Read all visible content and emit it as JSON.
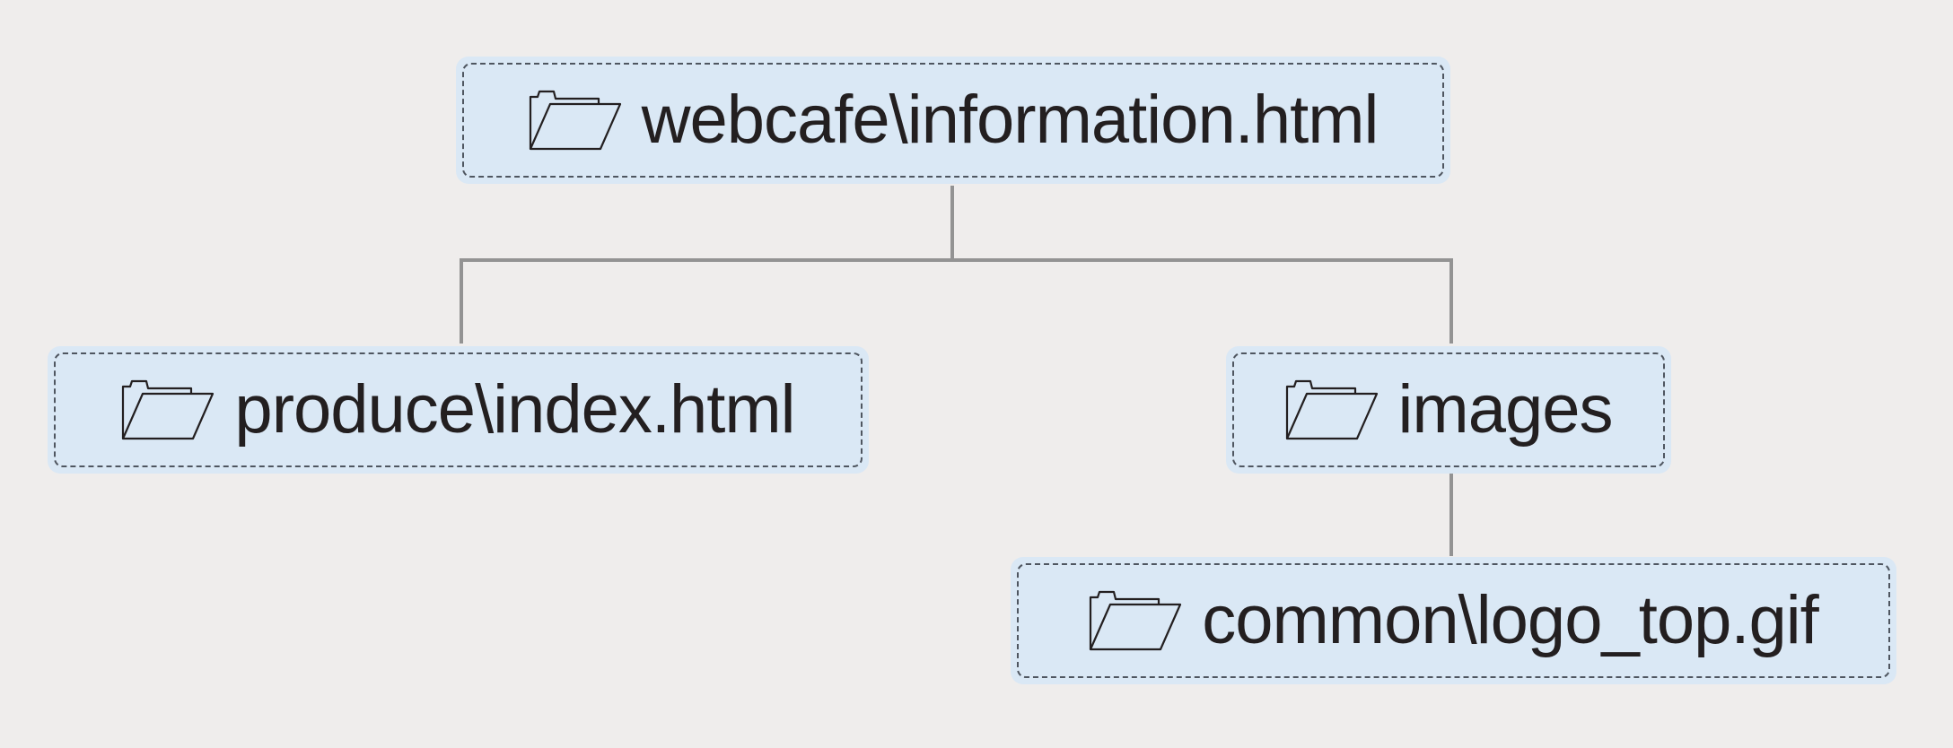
{
  "tree": {
    "root": {
      "label": "webcafe\\information.html",
      "icon": "folder-icon"
    },
    "children": [
      {
        "label": "produce\\index.html",
        "icon": "folder-icon"
      },
      {
        "label": "images",
        "icon": "folder-icon",
        "children": [
          {
            "label": "common\\logo_top.gif",
            "icon": "folder-icon"
          }
        ]
      }
    ]
  },
  "colors": {
    "background": "#efedec",
    "node_fill": "#dae8f5",
    "node_border": "#4f5660",
    "connector": "#939393",
    "text": "#231f20"
  }
}
